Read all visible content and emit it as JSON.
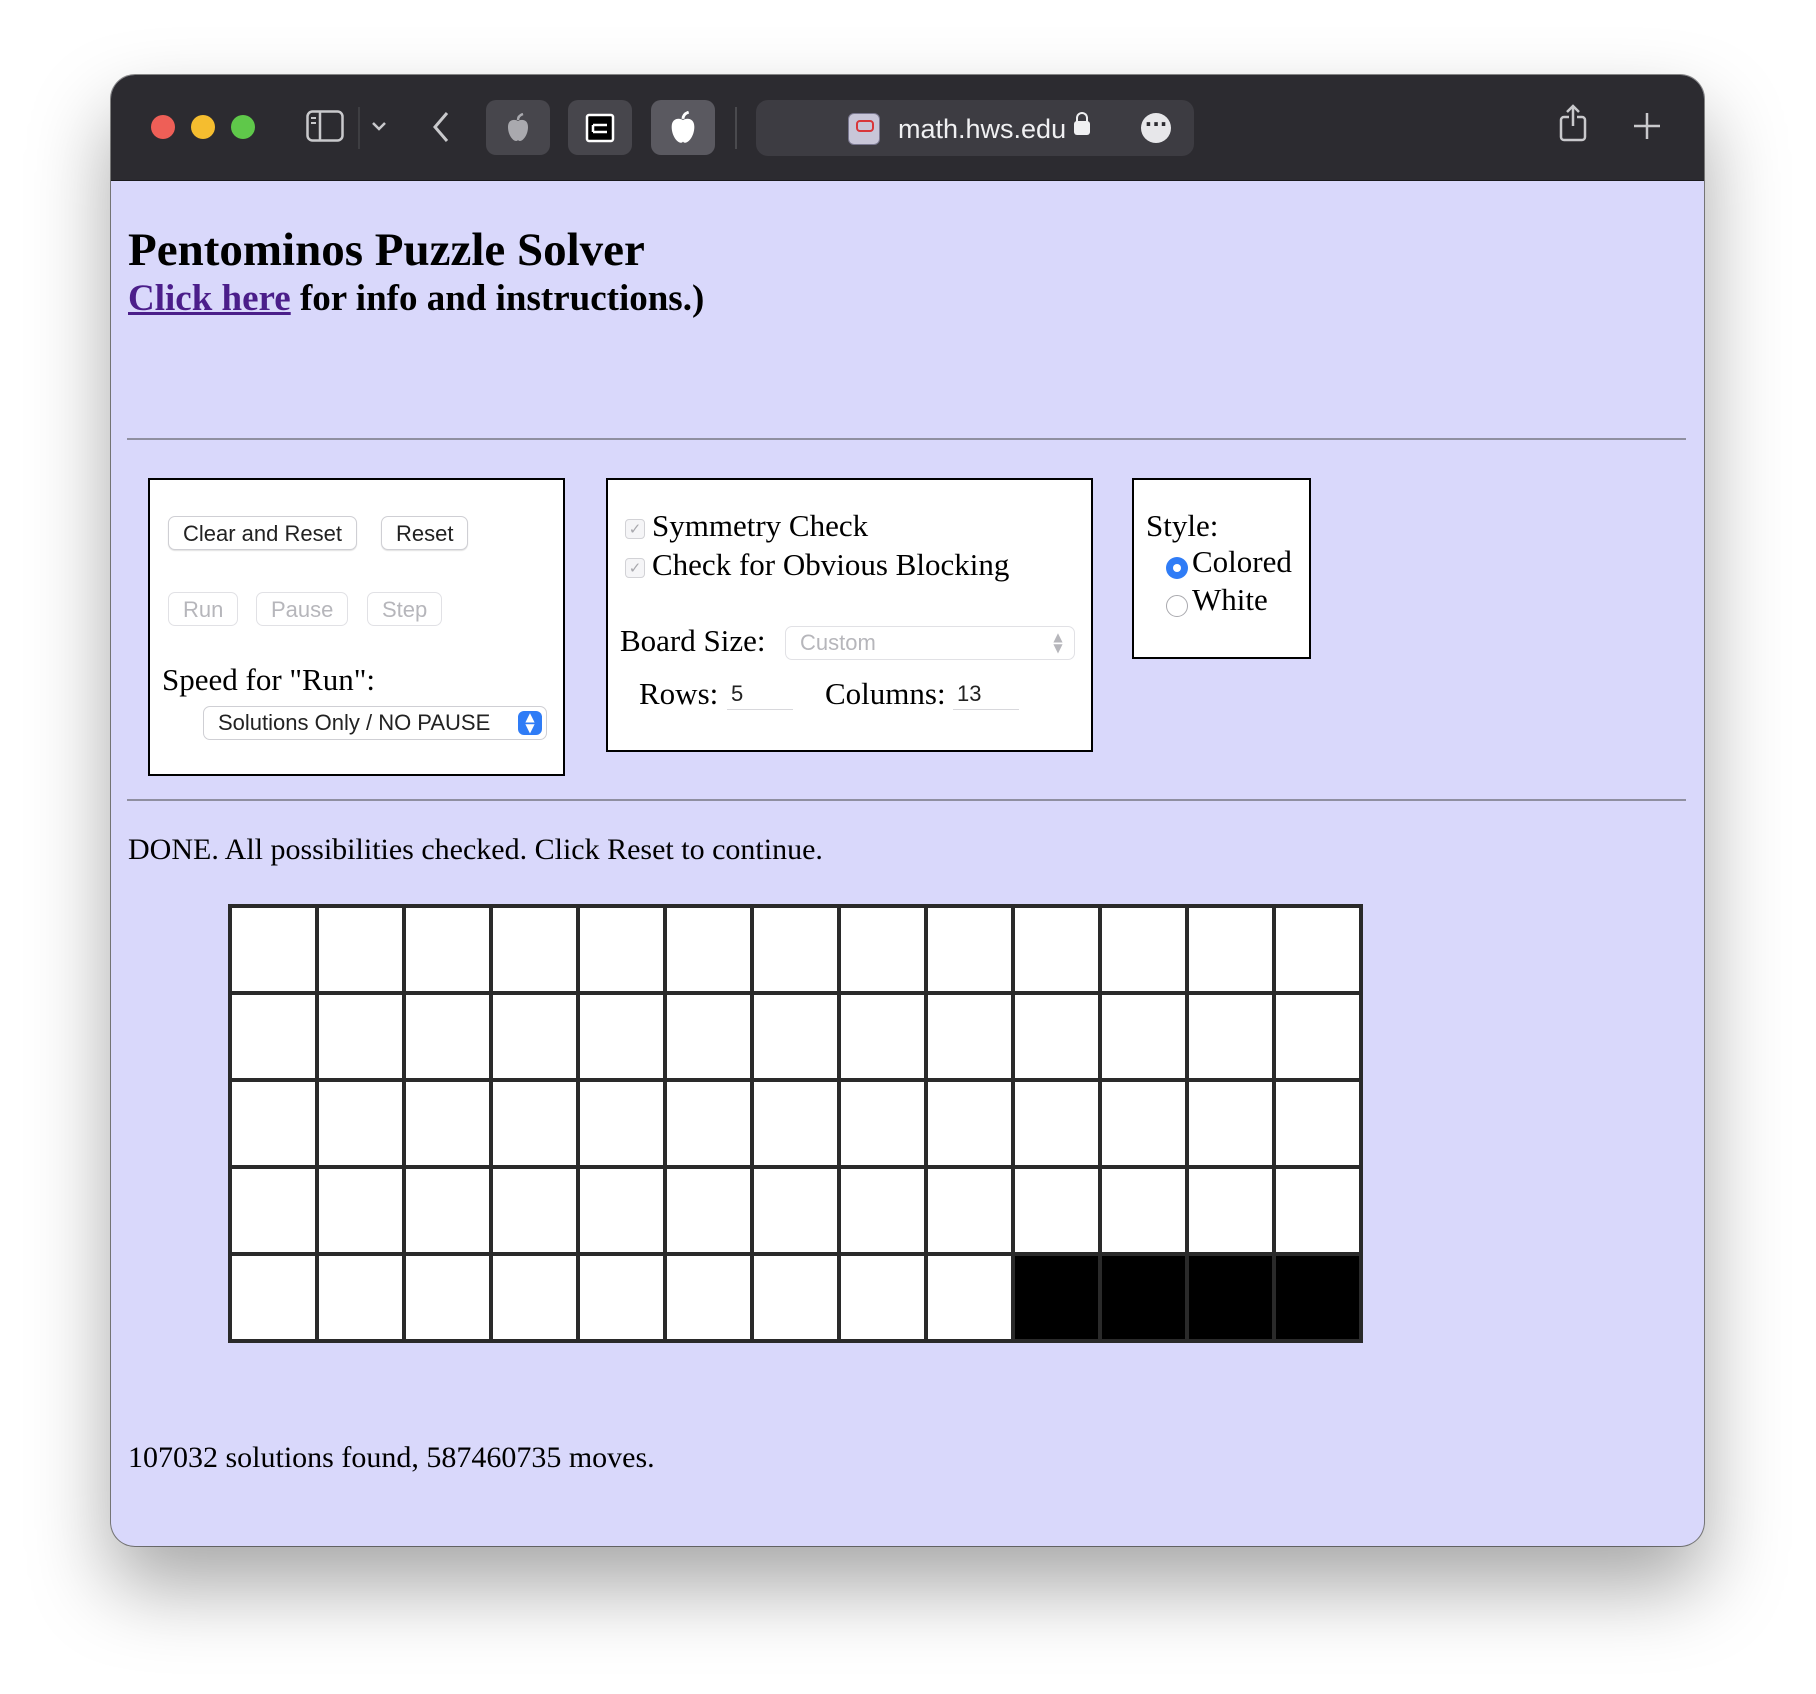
{
  "browser": {
    "url": "math.hws.edu"
  },
  "page": {
    "title": "Pentominos Puzzle Solver",
    "link_text": "Click here",
    "subtitle_rest": " for info and instructions.)"
  },
  "controls": {
    "clear_reset": "Clear and Reset",
    "reset": "Reset",
    "run": "Run",
    "pause": "Pause",
    "step": "Step",
    "speed_label": "Speed for \"Run\":",
    "speed_value": "Solutions Only / NO PAUSE"
  },
  "options": {
    "symmetry_check": "Symmetry Check",
    "obvious_blocking": "Check for Obvious Blocking",
    "board_size_label": "Board Size:",
    "board_size_value": "Custom",
    "rows_label": "Rows:",
    "rows_value": "5",
    "columns_label": "Columns:",
    "columns_value": "13"
  },
  "style": {
    "label": "Style:",
    "colored": "Colored",
    "white": "White",
    "selected": "Colored"
  },
  "status": "DONE. All possibilities checked. Click Reset to continue.",
  "board": {
    "rows": 5,
    "columns": 13,
    "black_cells": [
      [
        4,
        9
      ],
      [
        4,
        10
      ],
      [
        4,
        11
      ],
      [
        4,
        12
      ]
    ]
  },
  "result": "107032 solutions found, 587460735 moves."
}
